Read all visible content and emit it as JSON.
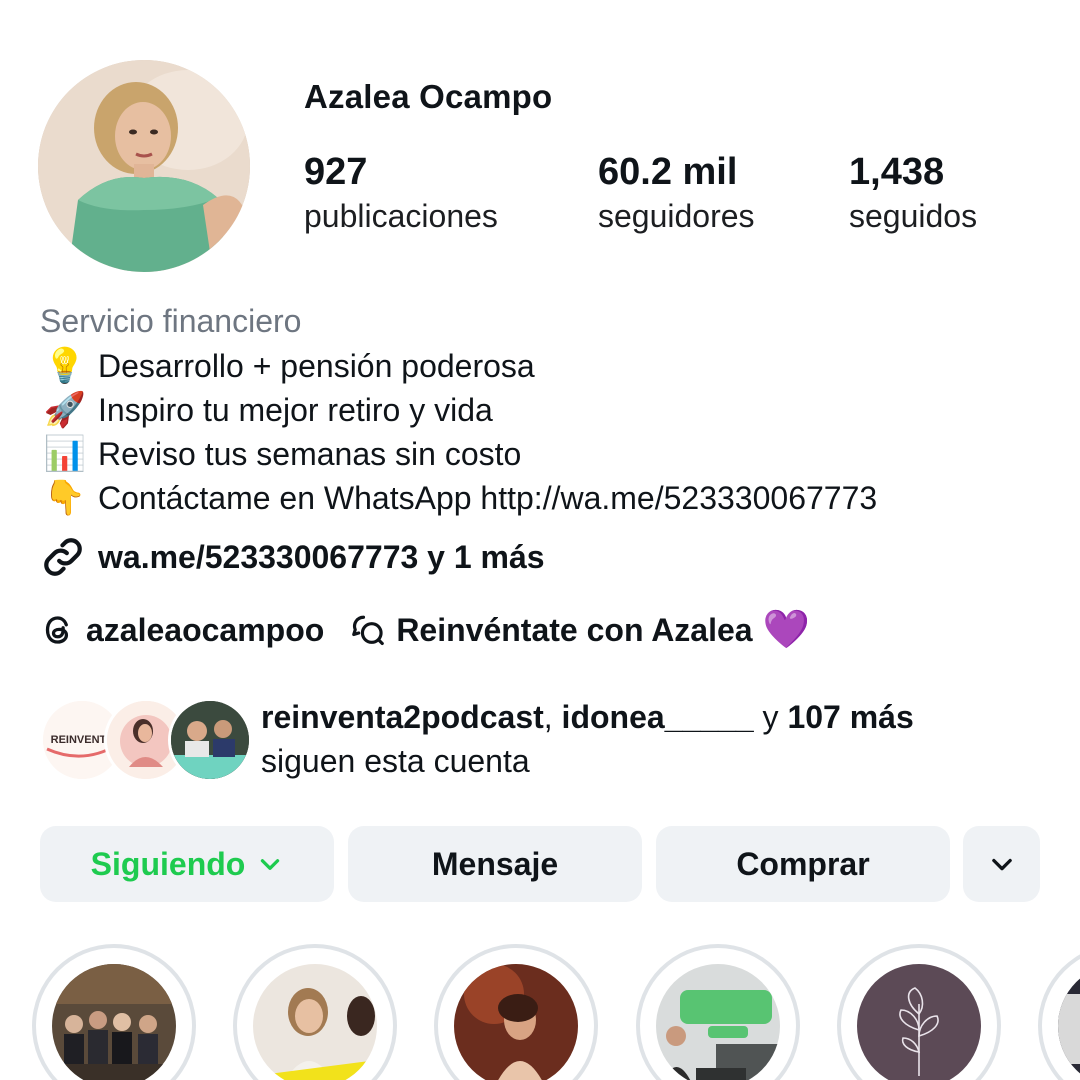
{
  "profile": {
    "username": "Azalea Ocampo",
    "stats": {
      "posts": {
        "value": "927",
        "label": "publicaciones"
      },
      "followers": {
        "value": "60.2 mil",
        "label": "seguidores"
      },
      "following": {
        "value": "1,438",
        "label": "seguidos"
      }
    },
    "category": "Servicio financiero",
    "bio": [
      {
        "emoji": "💡",
        "text": "Desarrollo + pensión poderosa"
      },
      {
        "emoji": "🚀",
        "text": "Inspiro tu mejor retiro y vida"
      },
      {
        "emoji": "📊",
        "text": "Reviso tus semanas sin costo"
      },
      {
        "emoji": "👇",
        "text": "Contáctame en WhatsApp http://wa.me/523330067773"
      }
    ],
    "link": "wa.me/523330067773 y 1 más",
    "threads_handle": "azaleaocampoo",
    "channel_name": "Reinvéntate con Azalea",
    "channel_emoji": "💜"
  },
  "mutual": {
    "account1": "reinventa2podcast",
    "separator": ", ",
    "account2": "idonea_____",
    "conjunction": " y ",
    "more": "107 más",
    "line2": "siguen esta cuenta",
    "avatar1_text": "REINVENTA"
  },
  "actions": {
    "follow_label": "Siguiendo",
    "message_label": "Mensaje",
    "shop_label": "Comprar"
  },
  "icons": {
    "link": "link-icon",
    "threads": "threads-icon",
    "channel": "broadcast-channel-icon",
    "chevron": "chevron-down-icon"
  },
  "colors": {
    "follow_green": "#1ecb4f",
    "button_bg": "#eff2f5",
    "category_gray": "#6e7681"
  }
}
